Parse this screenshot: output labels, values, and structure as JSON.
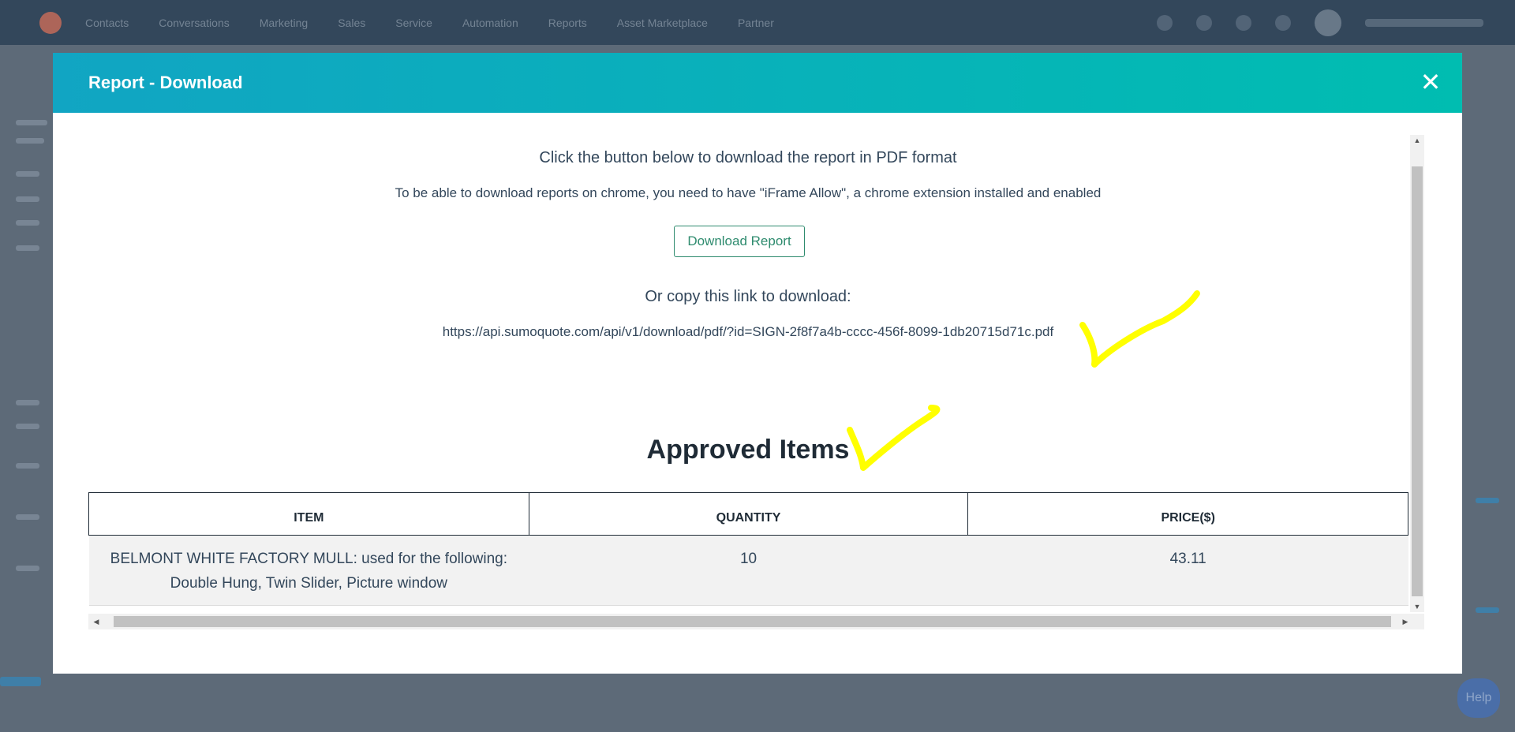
{
  "app_nav": {
    "items": [
      "Contacts",
      "Conversations",
      "Marketing",
      "Sales",
      "Service",
      "Automation",
      "Reports",
      "Asset Marketplace",
      "Partner"
    ]
  },
  "modal": {
    "title": "Report - Download",
    "close_icon": "close-icon",
    "instruction": "Click the button below to download the report in PDF format",
    "chrome_note": "To be able to download reports on chrome, you need to have \"iFrame Allow\", a chrome extension installed and enabled",
    "download_button": "Download Report",
    "copy_label": "Or copy this link to download:",
    "link": "https://api.sumoquote.com/api/v1/download/pdf/?id=SIGN-2f8f7a4b-cccc-456f-8099-1db20715d71c.pdf",
    "section_title": "Approved Items",
    "table": {
      "headers": [
        "ITEM",
        "QUANTITY",
        "PRICE($)"
      ],
      "rows": [
        {
          "item": "BELMONT WHITE FACTORY MULL: used for the following: Double Hung, Twin Slider, Picture window",
          "quantity": "10",
          "price": "43.11"
        }
      ]
    }
  },
  "help_button": "Help",
  "colors": {
    "header_start": "#11a5c3",
    "header_end": "#00bdb1",
    "button_accent": "#2e8b6e",
    "annotation": "#ffff00"
  }
}
